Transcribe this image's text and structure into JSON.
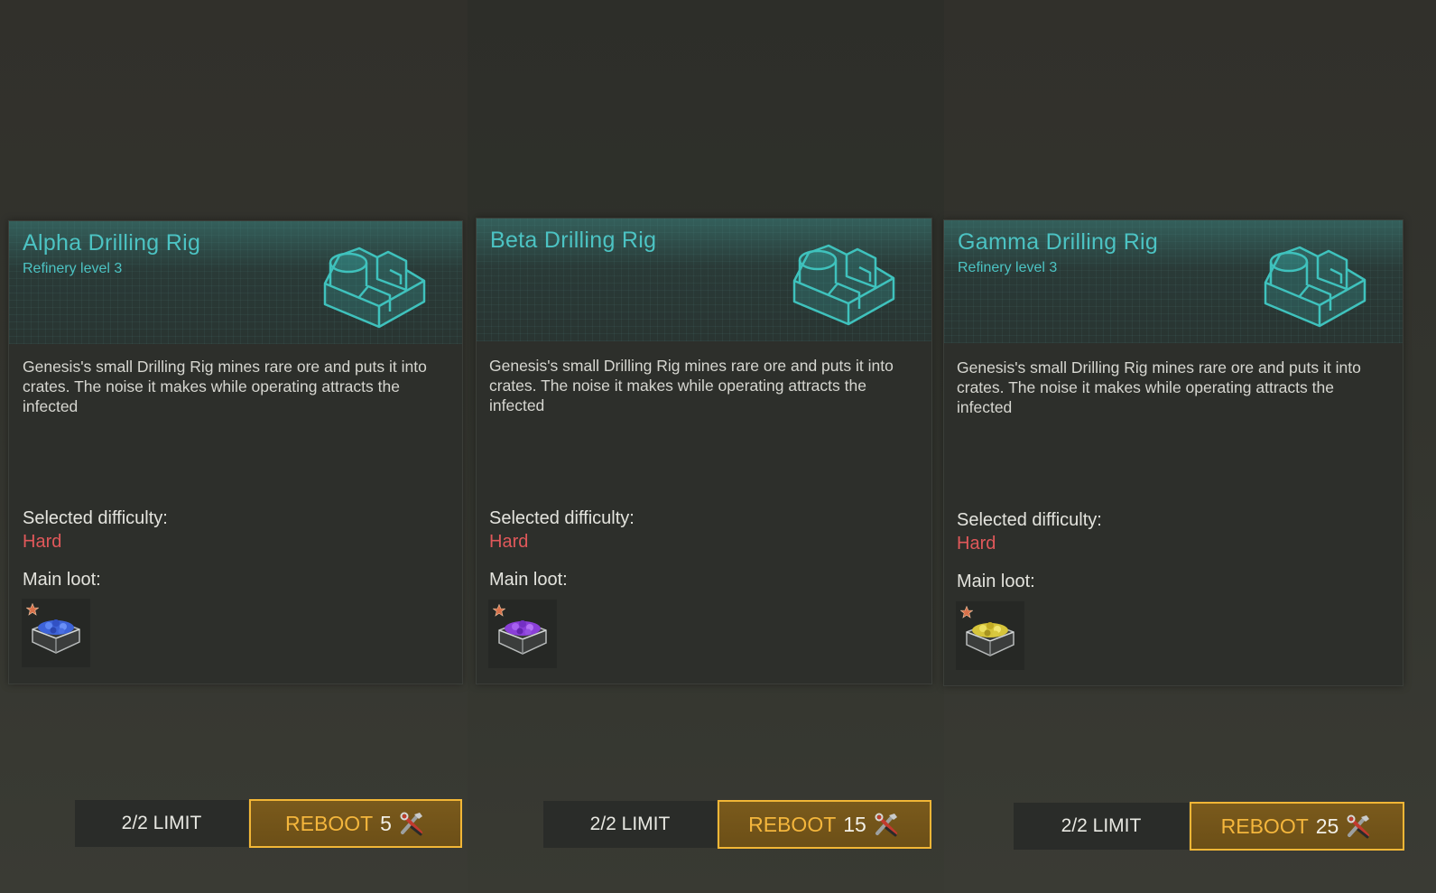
{
  "cards": [
    {
      "title": "Alpha Drilling Rig",
      "subtitle": "Refinery level 3",
      "description": "Genesis's small Drilling Rig mines rare ore and puts it into crates. The noise it makes while operating attracts the infected",
      "difficulty_label": "Selected difficulty:",
      "difficulty_value": "Hard",
      "loot_label": "Main loot:",
      "loot_color": "#3d63d8",
      "limit": "2/2 LIMIT",
      "reboot_label": "REBOOT",
      "reboot_cost": "5"
    },
    {
      "title": "Beta Drilling Rig",
      "subtitle": "",
      "description": "Genesis's small Drilling Rig mines rare ore and puts it into crates. The noise it makes while operating attracts the infected",
      "difficulty_label": "Selected difficulty:",
      "difficulty_value": "Hard",
      "loot_label": "Main loot:",
      "loot_color": "#8a3fd8",
      "limit": "2/2 LIMIT",
      "reboot_label": "REBOOT",
      "reboot_cost": "15"
    },
    {
      "title": "Gamma Drilling Rig",
      "subtitle": "Refinery level 3",
      "description": "Genesis's small Drilling Rig mines rare ore and puts it into crates. The noise it makes while operating attracts the infected",
      "difficulty_label": "Selected difficulty:",
      "difficulty_value": "Hard",
      "loot_label": "Main loot:",
      "loot_color": "#d6c43a",
      "limit": "2/2 LIMIT",
      "reboot_label": "REBOOT",
      "reboot_cost": "25"
    }
  ],
  "colors": {
    "title": "#4cc3c3",
    "difficulty_hard": "#e0585a",
    "reboot_border": "#f2b636"
  },
  "icons": [
    "drilling-rig-icon",
    "rarity-star-icon",
    "ore-crate-icon",
    "tools-icon"
  ]
}
